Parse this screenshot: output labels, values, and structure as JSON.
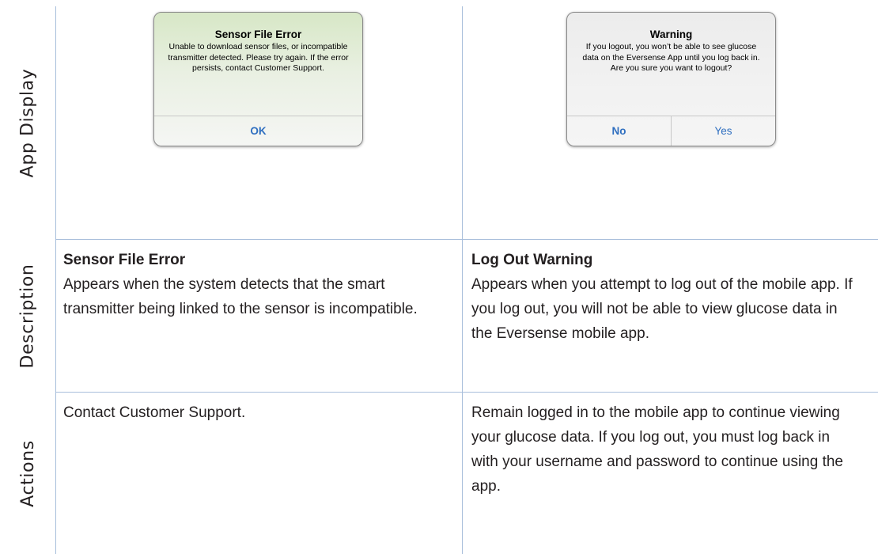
{
  "row_labels": {
    "app_display": "App Display",
    "description": "Description",
    "actions": "Actions"
  },
  "col1": {
    "alert": {
      "title": "Sensor File Error",
      "message": "Unable to download sensor files, or incompatible transmitter detected. Please try again. If the error persists, contact Customer Support.",
      "button": "OK"
    },
    "description": {
      "title": "Sensor File Error",
      "body": "Appears when the system detects that the smart transmitter being linked to the sensor is incompatible."
    },
    "actions": "Contact Customer Support."
  },
  "col2": {
    "alert": {
      "title": "Warning",
      "message": "If you logout, you won’t be able to see glucose data on the Eversense App until you log back in. Are you sure you want to logout?",
      "button_no": "No",
      "button_yes": "Yes"
    },
    "description": {
      "title": "Log Out Warning",
      "body": "Appears when you attempt to log out of the mobile app. If you log out, you will not be able to view glucose data in the Eversense mobile app."
    },
    "actions": "Remain logged in to the mobile app to continue viewing your glucose data. If you log out, you must log back in with your username and password to continue using the app."
  },
  "colors": {
    "grid_line": "#a8bedb",
    "button_text": "#2f6fc0",
    "alert_green_top": "#d7e7c6"
  }
}
